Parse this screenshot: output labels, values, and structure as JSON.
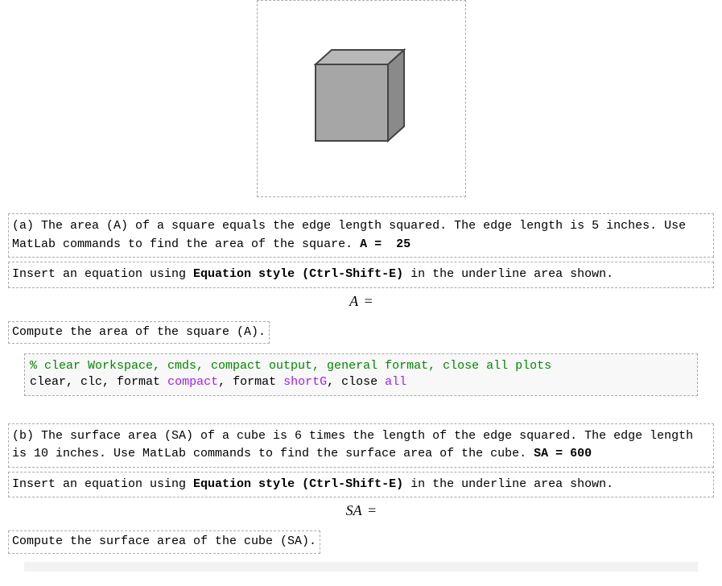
{
  "section_a": {
    "question_part1": "(a) The area (A) of a square equals the edge length squared. The edge length is 5 inches. Use MatLab commands to find the area of the square. ",
    "answer_label": "A = ",
    "answer_value": "25",
    "insert_eq_part1": "Insert an equation using ",
    "insert_eq_bold": "Equation style (Ctrl-Shift-E)",
    "insert_eq_part2": " in the underline area shown.",
    "equation_var": "A",
    "equation_eq": " =",
    "compute_text": "Compute the area of the square (A).",
    "code_comment": "% clear Workspace, cmds, compact output, general format, close all plots",
    "code_line2_p1": "clear, clc, ",
    "code_line2_kw1": "format",
    "code_line2_p2": " ",
    "code_line2_arg1": "compact",
    "code_line2_p3": ", ",
    "code_line2_kw2": "format",
    "code_line2_p4": " ",
    "code_line2_arg2": "shortG",
    "code_line2_p5": ", close ",
    "code_line2_arg3": "all"
  },
  "section_b": {
    "question_part1": "(b) The surface area (SA) of a cube is 6 times the length of the edge squared. The edge length is 10 inches. Use MatLab commands to find the surface area of the cube. ",
    "answer_label": "SA = ",
    "answer_value": "600",
    "insert_eq_part1": "Insert an equation using ",
    "insert_eq_bold": "Equation style (Ctrl-Shift-E)",
    "insert_eq_part2": " in the underline area shown.",
    "equation_var": "SA",
    "equation_eq": " =",
    "compute_text": "Compute the surface area of the cube (SA)."
  }
}
